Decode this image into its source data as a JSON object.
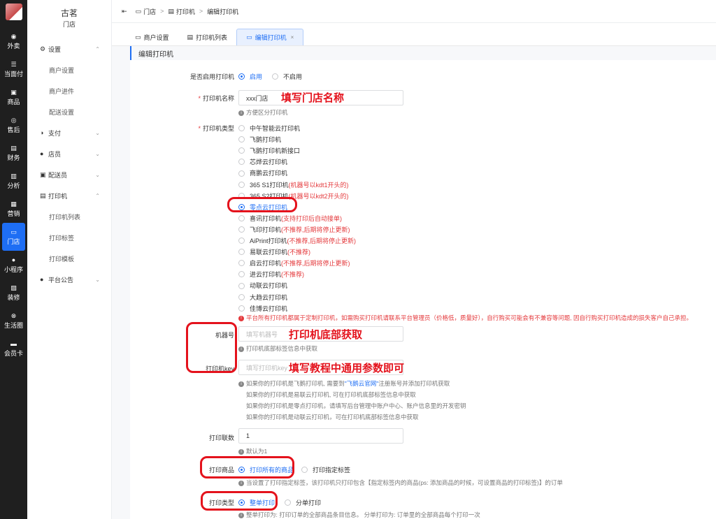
{
  "rail": {
    "items": [
      {
        "icon": "◉",
        "label": "外卖"
      },
      {
        "icon": "☰",
        "label": "当面付"
      },
      {
        "icon": "▣",
        "label": "商品"
      },
      {
        "icon": "◎",
        "label": "售后"
      },
      {
        "icon": "▤",
        "label": "财务"
      },
      {
        "icon": "▥",
        "label": "分析"
      },
      {
        "icon": "▦",
        "label": "营销"
      },
      {
        "icon": "▭",
        "label": "门店"
      },
      {
        "icon": "●",
        "label": "小程序"
      },
      {
        "icon": "▨",
        "label": "装修"
      },
      {
        "icon": "⊗",
        "label": "生活圈"
      },
      {
        "icon": "▬",
        "label": "会员卡"
      }
    ]
  },
  "sidebar": {
    "shop_name": "古茗",
    "shop_sub": "门店",
    "groups": [
      {
        "label": "设置",
        "icon": "⚙",
        "chev": "⌃"
      },
      {
        "label": "支付",
        "icon": "◑",
        "chev": "⌄"
      },
      {
        "label": "店员",
        "icon": "●",
        "chev": "⌄"
      },
      {
        "label": "配送员",
        "icon": "▣",
        "chev": "⌄"
      },
      {
        "label": "打印机",
        "icon": "▤",
        "chev": "⌃"
      },
      {
        "label": "平台公告",
        "icon": "●",
        "chev": "⌄"
      }
    ],
    "settings_items": [
      "商户设置",
      "商户进件",
      "配送设置"
    ],
    "printer_items": [
      "打印机列表",
      "打印标签",
      "打印模板"
    ]
  },
  "breadcrumb": {
    "toggle": "⇤",
    "items": [
      "门店",
      "打印机",
      "编辑打印机"
    ],
    "sep": ">"
  },
  "tabs": [
    {
      "label": "商户设置"
    },
    {
      "label": "打印机列表"
    },
    {
      "label": "编辑打印机",
      "close": "×"
    }
  ],
  "form": {
    "section_title": "编辑打印机",
    "enable": {
      "label": "是否启用打印机",
      "options": [
        "启用",
        "不启用"
      ],
      "selected": 0
    },
    "name": {
      "label": "打印机名称",
      "value": "xxx门店",
      "help": "方便区分打印机"
    },
    "type": {
      "label": "打印机类型",
      "options": [
        {
          "name": "中午智能云打印机",
          "note": ""
        },
        {
          "name": "飞鹅打印机",
          "note": ""
        },
        {
          "name": "飞鹅打印机新接口",
          "note": ""
        },
        {
          "name": "芯烨云打印机",
          "note": ""
        },
        {
          "name": "商鹏云打印机",
          "note": ""
        },
        {
          "name": "365 S1打印机",
          "note": "(机器号以kdt1开头的)"
        },
        {
          "name": "365 S2打印机",
          "note": "(机器号以kdt2开头的)"
        },
        {
          "name": "零点云打印机",
          "note": ""
        },
        {
          "name": "喜讯打印机",
          "note": "(支持打印后自动接单)"
        },
        {
          "name": "飞印打印机",
          "note": "(不推荐,后期将停止更新)"
        },
        {
          "name": "AiPrint打印机",
          "note": "(不推荐,后期将停止更新)"
        },
        {
          "name": "易联云打印机",
          "note": "(不推荐)"
        },
        {
          "name": "启云打印机",
          "note": "(不推荐,后期将停止更新)"
        },
        {
          "name": "进云打印机",
          "note": "(不推荐)"
        },
        {
          "name": "动联云打印机",
          "note": ""
        },
        {
          "name": "大趋云打印机",
          "note": ""
        },
        {
          "name": "佳博云打印机",
          "note": ""
        }
      ],
      "selected": 7,
      "warning": "平台所有打印机都属于定制打印机，如需购买打印机请联系平台管理员（价格低，质量好），自行购买可能会有不兼容等问题, 因自行购买打印机造成的损失客户自己承担。"
    },
    "machine_no": {
      "label": "机器号",
      "placeholder": "填写机器号",
      "help": "打印机底部标签信息中获取"
    },
    "key": {
      "label": "打印机key",
      "placeholder": "填写打印机key",
      "help_1_pre": "如果你的打印机是飞鹅打印机, 需要到",
      "help_1_link": "\"飞鹅云官网\"",
      "help_1_post": "注册账号并添加打印机获取",
      "help_2": "如果你的打印机是易联云打印机, 可在打印机底部标签信息中获取",
      "help_3": "如果你的打印机是零点打印机，请填写后台管理中账户中心、账户信息里的开发密钥",
      "help_4": "如果你的打印机是动联云打印机，可在打印机底部标签信息中获取"
    },
    "copies": {
      "label": "打印联数",
      "value": "1",
      "help": "默认为1"
    },
    "goods": {
      "label": "打印商品",
      "options": [
        "打印所有的商品",
        "打印指定标签"
      ],
      "selected": 0,
      "help": "当设置了打印指定标签，该打印机只打印包含【指定标签内的商品(ps: 添加商品的时候，可设置商品的打印标签)】的订单"
    },
    "print_type": {
      "label": "打印类型",
      "options": [
        "整单打印",
        "分单打印"
      ],
      "selected": 0,
      "help": "整单打印为:  打印订单的全部商品条目信息。 分单打印为:  订单里的全部商品每个打印一次"
    }
  },
  "annotations": {
    "name": "填写门店名称",
    "machine": "打印机底部获取",
    "key": "填写教程中通用参数即可"
  },
  "colors": {
    "accent": "#1e6ef4",
    "rail": "#1f1f1f",
    "highlight": "#e4121c"
  }
}
